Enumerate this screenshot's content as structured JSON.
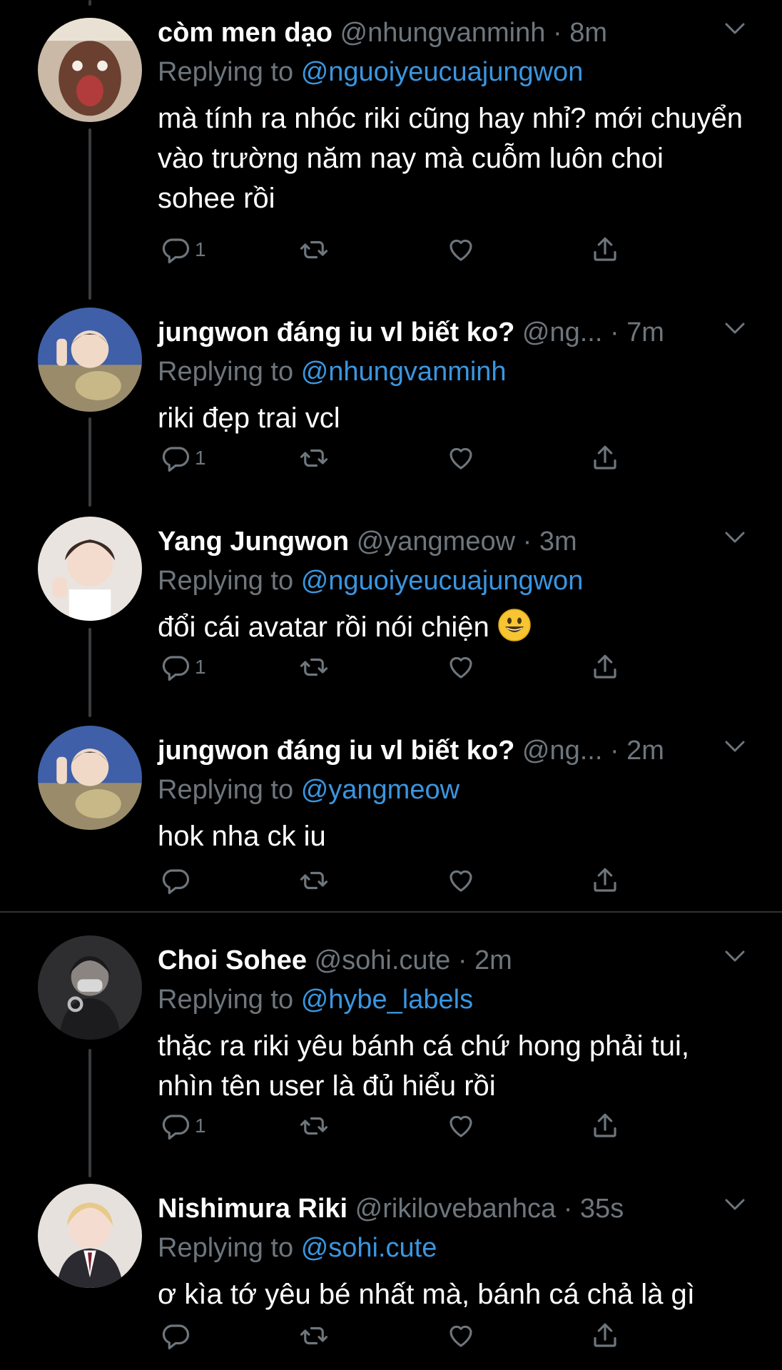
{
  "reply_prefix": "Replying to",
  "icons": {
    "reply": "reply-icon",
    "retweet": "retweet-icon",
    "like": "heart-icon",
    "share": "share-icon",
    "more": "chevron-down-icon"
  },
  "colors": {
    "background": "#000000",
    "secondary_text": "#6e767d",
    "link": "#3a96e0"
  },
  "tweets": [
    {
      "name": "còm men dạo",
      "handle": "@nhungvanminh",
      "time": "8m",
      "replying_to": "@nguoiyeucuajungwon",
      "body": "mà tính ra nhóc riki cũng hay nhỉ? mới chuyển vào trường năm nay mà cuỗm luôn choi sohee rồi",
      "reply_count": "1"
    },
    {
      "name": "jungwon đáng iu vl biết ko?",
      "handle": "@ng...",
      "time": "7m",
      "replying_to": "@nhungvanminh",
      "body": "riki đẹp trai vcl",
      "reply_count": "1"
    },
    {
      "name": "Yang Jungwon",
      "handle": "@yangmeow",
      "time": "3m",
      "replying_to": "@nguoiyeucuajungwon",
      "body": "đổi cái avatar rồi nói chiện",
      "emoji": "grinning-face-emoji",
      "reply_count": "1"
    },
    {
      "name": "jungwon đáng iu vl biết ko?",
      "handle": "@ng...",
      "time": "2m",
      "replying_to": "@yangmeow",
      "body": "hok nha ck iu",
      "reply_count": ""
    },
    {
      "name": "Choi Sohee",
      "handle": "@sohi.cute",
      "time": "2m",
      "replying_to": "@hybe_labels",
      "body": "thặc ra riki yêu bánh cá chứ hong phải tui, nhìn tên user là đủ hiểu rồi",
      "reply_count": "1"
    },
    {
      "name": "Nishimura Riki",
      "handle": "@rikilovebanhca",
      "time": "35s",
      "replying_to": "@sohi.cute",
      "body": "ơ kìa tớ yêu bé nhất mà, bánh cá chả là gì",
      "reply_count": ""
    }
  ]
}
